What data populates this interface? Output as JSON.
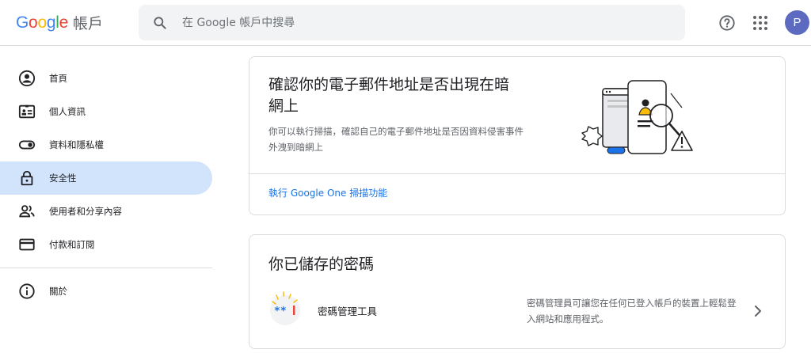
{
  "header": {
    "logo_text": "Google",
    "product": "帳戶",
    "search_placeholder": "在 Google 帳戶中搜尋",
    "avatar_letter": "P"
  },
  "sidebar": {
    "items": [
      {
        "label": "首頁",
        "icon": "home-account-icon"
      },
      {
        "label": "個人資訊",
        "icon": "id-card-icon"
      },
      {
        "label": "資料和隱私權",
        "icon": "toggle-icon"
      },
      {
        "label": "安全性",
        "icon": "lock-icon",
        "active": true
      },
      {
        "label": "使用者和分享內容",
        "icon": "people-icon"
      },
      {
        "label": "付款和訂閱",
        "icon": "credit-card-icon"
      },
      {
        "label": "關於",
        "icon": "info-icon"
      }
    ]
  },
  "card_dark_web": {
    "title": "確認你的電子郵件地址是否出現在暗網上",
    "description": "你可以執行掃描，確認自己的電子郵件地址是否因資料侵害事件外洩到暗網上",
    "link": "執行 Google One 掃描功能"
  },
  "card_passwords": {
    "title": "你已儲存的密碼",
    "manager_label": "密碼管理工具",
    "manager_description": "密碼管理員可讓您在任何已登入帳戶的裝置上輕鬆登入網站和應用程式。",
    "icon_text": "**|"
  },
  "colors": {
    "accent": "#1a73e8",
    "active_nav": "#d2e3fc",
    "avatar": "#5c6bc0"
  }
}
